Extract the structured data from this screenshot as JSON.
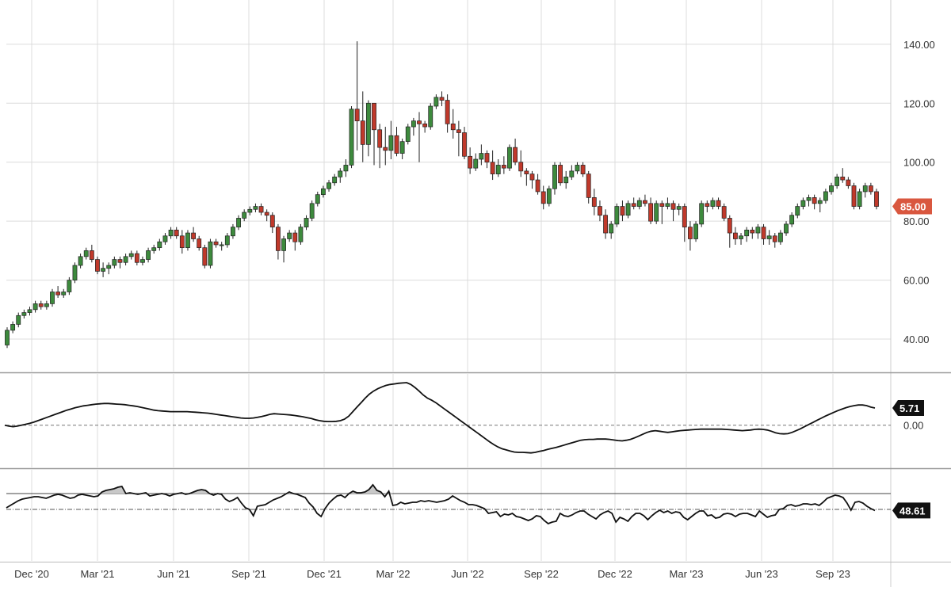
{
  "chart_data": [
    {
      "type": "candlestick",
      "title": "",
      "x_tick_labels": [
        "Dec '20",
        "Mar '21",
        "Jun '21",
        "Sep '21",
        "Dec '21",
        "Mar '22",
        "Jun '22",
        "Sep '22",
        "Dec '22",
        "Mar '23",
        "Jun '23",
        "Sep '23"
      ],
      "y_tick_labels": [
        "40.00",
        "60.00",
        "80.00",
        "100.00",
        "120.00",
        "140.00"
      ],
      "y_ticks": [
        40,
        60,
        80,
        100,
        120,
        140
      ],
      "ylim": [
        29,
        155
      ],
      "grid": true,
      "up_color": "#3d8a3d",
      "down_color": "#c0392b",
      "last_price_label": "85.00",
      "last_price": 85,
      "ohlc": [
        [
          38,
          44,
          37,
          43
        ],
        [
          43,
          46,
          42,
          45
        ],
        [
          45,
          49,
          44,
          48
        ],
        [
          48,
          50,
          47,
          49
        ],
        [
          49,
          51,
          48,
          50
        ],
        [
          50,
          53,
          49,
          52
        ],
        [
          52,
          53,
          50,
          51
        ],
        [
          51,
          53,
          50,
          52
        ],
        [
          52,
          57,
          51,
          56
        ],
        [
          56,
          58,
          54,
          55
        ],
        [
          55,
          57,
          54,
          56
        ],
        [
          56,
          61,
          55,
          60
        ],
        [
          60,
          66,
          59,
          65
        ],
        [
          65,
          69,
          64,
          68
        ],
        [
          68,
          71,
          67,
          70
        ],
        [
          70,
          72,
          66,
          67
        ],
        [
          67,
          68,
          62,
          63
        ],
        [
          63,
          66,
          61,
          64
        ],
        [
          64,
          66,
          62,
          65
        ],
        [
          65,
          68,
          64,
          67
        ],
        [
          67,
          68,
          64,
          66
        ],
        [
          66,
          69,
          65,
          68
        ],
        [
          68,
          70,
          67,
          69
        ],
        [
          69,
          70,
          65,
          66
        ],
        [
          66,
          68,
          65,
          67
        ],
        [
          67,
          71,
          66,
          70
        ],
        [
          70,
          72,
          69,
          71
        ],
        [
          71,
          74,
          70,
          73
        ],
        [
          73,
          76,
          72,
          75
        ],
        [
          75,
          78,
          74,
          77
        ],
        [
          77,
          78,
          74,
          75
        ],
        [
          75,
          77,
          69,
          71
        ],
        [
          71,
          77,
          70,
          76
        ],
        [
          76,
          78,
          73,
          74
        ],
        [
          74,
          75,
          70,
          71
        ],
        [
          71,
          72,
          64,
          65
        ],
        [
          65,
          74,
          64,
          73
        ],
        [
          73,
          74,
          71,
          72
        ],
        [
          72,
          73,
          70,
          72
        ],
        [
          72,
          76,
          71,
          75
        ],
        [
          75,
          79,
          74,
          78
        ],
        [
          78,
          82,
          77,
          81
        ],
        [
          81,
          84,
          80,
          83
        ],
        [
          83,
          85,
          82,
          84
        ],
        [
          84,
          86,
          83,
          85
        ],
        [
          85,
          86,
          82,
          83
        ],
        [
          83,
          84,
          80,
          82
        ],
        [
          82,
          83,
          76,
          78
        ],
        [
          78,
          79,
          67,
          70
        ],
        [
          70,
          75,
          66,
          74
        ],
        [
          74,
          77,
          73,
          76
        ],
        [
          76,
          77,
          70,
          73
        ],
        [
          73,
          79,
          72,
          78
        ],
        [
          78,
          82,
          77,
          81
        ],
        [
          81,
          87,
          80,
          86
        ],
        [
          86,
          90,
          85,
          89
        ],
        [
          89,
          92,
          88,
          91
        ],
        [
          91,
          94,
          90,
          93
        ],
        [
          93,
          96,
          92,
          95
        ],
        [
          95,
          98,
          93,
          97
        ],
        [
          97,
          101,
          95,
          99
        ],
        [
          99,
          119,
          98,
          118
        ],
        [
          118,
          141,
          104,
          114
        ],
        [
          114,
          124,
          100,
          106
        ],
        [
          106,
          121,
          102,
          120
        ],
        [
          120,
          116,
          99,
          111
        ],
        [
          111,
          113,
          98,
          105
        ],
        [
          105,
          112,
          99,
          104
        ],
        [
          104,
          114,
          101,
          109
        ],
        [
          109,
          112,
          102,
          103
        ],
        [
          103,
          108,
          101,
          107
        ],
        [
          107,
          113,
          106,
          112
        ],
        [
          112,
          115,
          109,
          114
        ],
        [
          114,
          117,
          100,
          113
        ],
        [
          113,
          114,
          110,
          112
        ],
        [
          112,
          120,
          111,
          119
        ],
        [
          119,
          123,
          118,
          122
        ],
        [
          122,
          124,
          119,
          121
        ],
        [
          121,
          123,
          110,
          113
        ],
        [
          113,
          118,
          108,
          111
        ],
        [
          111,
          114,
          102,
          110
        ],
        [
          110,
          112,
          101,
          102
        ],
        [
          102,
          105,
          96,
          98
        ],
        [
          98,
          103,
          97,
          101
        ],
        [
          101,
          106,
          99,
          103
        ],
        [
          103,
          104,
          98,
          100
        ],
        [
          100,
          104,
          94,
          96
        ],
        [
          96,
          101,
          95,
          99
        ],
        [
          99,
          102,
          96,
          98
        ],
        [
          98,
          106,
          97,
          105
        ],
        [
          105,
          108,
          99,
          100
        ],
        [
          100,
          104,
          95,
          97
        ],
        [
          97,
          98,
          92,
          96
        ],
        [
          96,
          97,
          91,
          94
        ],
        [
          94,
          96,
          89,
          90
        ],
        [
          90,
          92,
          84,
          86
        ],
        [
          86,
          92,
          85,
          91
        ],
        [
          91,
          100,
          89,
          99
        ],
        [
          99,
          100,
          92,
          93
        ],
        [
          93,
          97,
          91,
          95
        ],
        [
          95,
          99,
          94,
          97
        ],
        [
          97,
          100,
          96,
          99
        ],
        [
          99,
          100,
          95,
          96
        ],
        [
          96,
          97,
          86,
          88
        ],
        [
          88,
          91,
          82,
          85
        ],
        [
          85,
          87,
          80,
          82
        ],
        [
          82,
          84,
          74,
          76
        ],
        [
          76,
          80,
          74,
          79
        ],
        [
          79,
          86,
          78,
          85
        ],
        [
          85,
          87,
          80,
          82
        ],
        [
          82,
          87,
          81,
          86
        ],
        [
          86,
          88,
          84,
          85
        ],
        [
          85,
          88,
          84,
          87
        ],
        [
          87,
          89,
          85,
          86
        ],
        [
          86,
          88,
          79,
          80
        ],
        [
          80,
          87,
          79,
          86
        ],
        [
          86,
          87,
          79,
          85
        ],
        [
          85,
          88,
          84,
          86
        ],
        [
          86,
          87,
          80,
          84
        ],
        [
          84,
          86,
          82,
          85
        ],
        [
          85,
          86,
          73,
          78
        ],
        [
          78,
          80,
          70,
          74
        ],
        [
          74,
          80,
          73,
          79
        ],
        [
          79,
          87,
          78,
          86
        ],
        [
          86,
          87,
          83,
          85
        ],
        [
          85,
          88,
          84,
          87
        ],
        [
          87,
          88,
          84,
          85
        ],
        [
          85,
          86,
          80,
          81
        ],
        [
          81,
          82,
          71,
          76
        ],
        [
          76,
          78,
          72,
          74
        ],
        [
          74,
          76,
          72,
          75
        ],
        [
          75,
          78,
          73,
          77
        ],
        [
          77,
          78,
          74,
          76
        ],
        [
          76,
          79,
          74,
          78
        ],
        [
          78,
          79,
          72,
          74
        ],
        [
          74,
          77,
          72,
          75
        ],
        [
          75,
          76,
          71,
          73
        ],
        [
          73,
          77,
          72,
          76
        ],
        [
          76,
          80,
          75,
          79
        ],
        [
          79,
          83,
          78,
          82
        ],
        [
          82,
          86,
          81,
          85
        ],
        [
          85,
          88,
          84,
          87
        ],
        [
          87,
          89,
          85,
          88
        ],
        [
          88,
          89,
          84,
          86
        ],
        [
          86,
          88,
          83,
          87
        ],
        [
          87,
          91,
          86,
          90
        ],
        [
          90,
          93,
          89,
          92
        ],
        [
          92,
          96,
          91,
          95
        ],
        [
          95,
          98,
          93,
          94
        ],
        [
          94,
          95,
          91,
          92
        ],
        [
          92,
          93,
          84,
          85
        ],
        [
          85,
          91,
          84,
          90
        ],
        [
          90,
          93,
          88,
          92
        ],
        [
          92,
          93,
          89,
          90
        ],
        [
          90,
          91,
          84,
          85
        ]
      ]
    },
    {
      "type": "line",
      "title": "",
      "y_tick_labels": [
        "0.00"
      ],
      "zero_line": 0,
      "ylim": [
        -14,
        17
      ],
      "last_value_label": "5.71",
      "values": [
        0,
        -0.3,
        -0.5,
        -0.3,
        0,
        0.3,
        0.6,
        1,
        1.5,
        2,
        2.5,
        3,
        3.5,
        4,
        4.5,
        5,
        5.4,
        5.8,
        6.1,
        6.4,
        6.6,
        6.8,
        7,
        7.1,
        7.2,
        7.2,
        7.1,
        7,
        6.9,
        6.8,
        6.6,
        6.4,
        6.2,
        5.9,
        5.6,
        5.3,
        5,
        4.8,
        4.7,
        4.6,
        4.5,
        4.5,
        4.5,
        4.5,
        4.5,
        4.4,
        4.3,
        4.2,
        4.1,
        4,
        3.8,
        3.6,
        3.4,
        3.2,
        3,
        2.8,
        2.6,
        2.4,
        2.3,
        2.3,
        2.4,
        2.6,
        2.9,
        3.2,
        3.6,
        3.8,
        3.7,
        3.6,
        3.5,
        3.4,
        3.2,
        3,
        2.8,
        2.5,
        2.2,
        1.8,
        1.5,
        1.3,
        1.2,
        1.2,
        1.3,
        1.5,
        2,
        3,
        4.5,
        6,
        7.5,
        9,
        10.3,
        11.3,
        12.1,
        12.7,
        13.2,
        13.5,
        13.7,
        13.9,
        14,
        14.1,
        13.5,
        12.5,
        11.3,
        10,
        9,
        8.3,
        7.5,
        6.5,
        5.5,
        4.5,
        3.5,
        2.5,
        1.5,
        0.5,
        -0.5,
        -1.5,
        -2.5,
        -3.5,
        -4.5,
        -5.5,
        -6.4,
        -7.2,
        -7.8,
        -8.2,
        -8.6,
        -8.9,
        -9,
        -9,
        -9.1,
        -9.2,
        -9,
        -8.7,
        -8.4,
        -8,
        -7.7,
        -7.4,
        -7,
        -6.6,
        -6.2,
        -5.8,
        -5.4,
        -5,
        -4.8,
        -4.7,
        -4.7,
        -4.6,
        -4.6,
        -4.6,
        -4.7,
        -4.9,
        -5.1,
        -5.2,
        -5,
        -4.7,
        -4.2,
        -3.6,
        -3,
        -2.4,
        -2,
        -1.8,
        -2,
        -2.2,
        -2.4,
        -2.2,
        -2,
        -1.8,
        -1.7,
        -1.6,
        -1.5,
        -1.4,
        -1.3,
        -1.3,
        -1.3,
        -1.3,
        -1.3,
        -1.3,
        -1.4,
        -1.5,
        -1.6,
        -1.7,
        -1.8,
        -1.7,
        -1.6,
        -1.4,
        -1.3,
        -1.4,
        -1.6,
        -2,
        -2.5,
        -2.8,
        -2.9,
        -2.8,
        -2.4,
        -1.8,
        -1.2,
        -0.5,
        0.2,
        0.9,
        1.6,
        2.3,
        3,
        3.6,
        4.2,
        4.8,
        5.3,
        5.8,
        6.2,
        6.5,
        6.7,
        6.7,
        6.5,
        6,
        5.7
      ]
    },
    {
      "type": "line",
      "title": "",
      "upper_level": 70,
      "lower_level": 50,
      "ylim": [
        -15,
        100
      ],
      "last_value_label": "48.61",
      "values": [
        52,
        55,
        58,
        61,
        63,
        64,
        65,
        66,
        66,
        65,
        64,
        66,
        68,
        69,
        68,
        66,
        64,
        65,
        68,
        69,
        68,
        67,
        66,
        67,
        72,
        74,
        75,
        76,
        78,
        79,
        70,
        71,
        70,
        69,
        70,
        71,
        67,
        68,
        69,
        70,
        69,
        67,
        69,
        70,
        71,
        69,
        70,
        72,
        74,
        75,
        74,
        70,
        68,
        70,
        69,
        63,
        60,
        62,
        65,
        58,
        52,
        50,
        42,
        54,
        55,
        56,
        59,
        62,
        64,
        66,
        69,
        72,
        70,
        69,
        67,
        65,
        58,
        53,
        45,
        41,
        51,
        58,
        63,
        67,
        68,
        65,
        70,
        73,
        71,
        71,
        72,
        75,
        81,
        74,
        72,
        66,
        73,
        55,
        56,
        59,
        57,
        58,
        59,
        59,
        61,
        60,
        61,
        60,
        59,
        60,
        61,
        63,
        67,
        64,
        61,
        59,
        56,
        56,
        55,
        53,
        51,
        45,
        46,
        47,
        41,
        44,
        43,
        45,
        41,
        40,
        38,
        36,
        38,
        42,
        41,
        36,
        32,
        34,
        35,
        45,
        42,
        41,
        43,
        46,
        48,
        48,
        44,
        41,
        38,
        43,
        46,
        48,
        45,
        34,
        40,
        38,
        35,
        41,
        45,
        45,
        42,
        37,
        42,
        46,
        49,
        46,
        48,
        45,
        47,
        46,
        40,
        37,
        41,
        45,
        48,
        48,
        42,
        43,
        39,
        40,
        44,
        45,
        44,
        41,
        44,
        45,
        45,
        43,
        41,
        48,
        44,
        40,
        42,
        43,
        50,
        51,
        55,
        56,
        54,
        55,
        57,
        57,
        56,
        57,
        55,
        59,
        64,
        66,
        68,
        67,
        65,
        58,
        49,
        59,
        60,
        58,
        54,
        51,
        48.61
      ]
    }
  ]
}
